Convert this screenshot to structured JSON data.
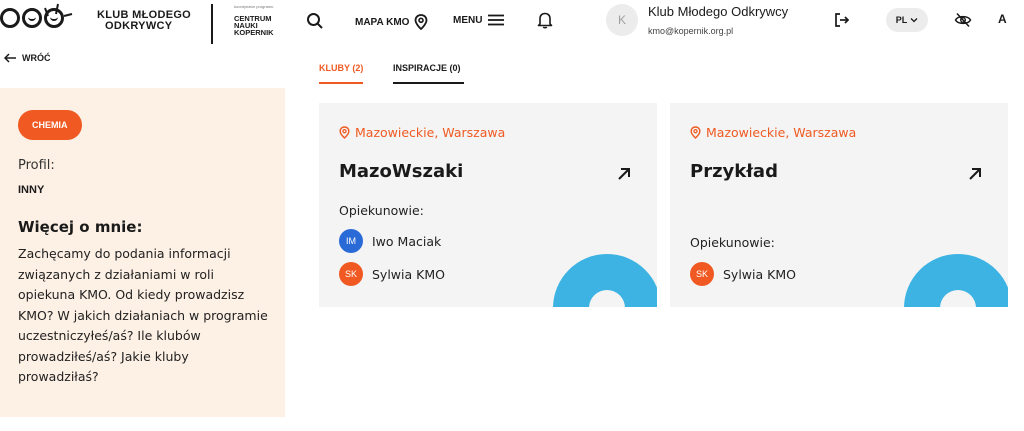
{
  "header": {
    "logo_line1": "KLUB MŁODEGO",
    "logo_line2": "ODKRYWCY",
    "partner_small": "koordynator programu",
    "partner_line1": "CENTRUM",
    "partner_line2": "NAUKI",
    "partner_line3": "KOPERNIK",
    "map_label": "MAPA KMO",
    "menu_label": "MENU",
    "user_initial": "K",
    "user_name": "Klub Młodego Odkrywcy",
    "user_email": "kmo@kopernik.org.pl",
    "lang": "PL",
    "font_size_label": "A"
  },
  "back_label": "WRÓĆ",
  "tabs": [
    {
      "label": "KLUBY (2)",
      "active": true
    },
    {
      "label": "INSPIRACJE (0)",
      "active": false
    }
  ],
  "profile": {
    "chip": "CHEMIA",
    "profile_label": "Profil:",
    "profile_value": "INNY",
    "about_heading": "Więcej o mnie:",
    "about_text": "Zachęcamy do podania informacji związanych z działaniami w roli opiekuna KMO. Od kiedy prowadzisz KMO? W jakich działaniach w programie uczestniczyłeś/aś? Ile klubów prowadziłeś/aś? Jakie kluby prowadziłaś?"
  },
  "clubs": [
    {
      "location": "Mazowieckie, Warszawa",
      "name": "MazoWszaki",
      "guardians_label": "Opiekunowie:",
      "guardians": [
        {
          "initials": "IM",
          "name": "Iwo Maciak",
          "color": "#2a6ad6"
        },
        {
          "initials": "SK",
          "name": "Sylwia KMO",
          "color": "#f05a22"
        }
      ]
    },
    {
      "location": "Mazowieckie, Warszawa",
      "name": "Przykład",
      "guardians_label": "Opiekunowie:",
      "guardians": [
        {
          "initials": "SK",
          "name": "Sylwia KMO",
          "color": "#f05a22"
        }
      ]
    }
  ],
  "colors": {
    "accent": "#f05a22",
    "panel_bg": "#fdf0e4",
    "card_bg": "#f4f4f4",
    "deco_blue": "#3db3e3",
    "badge_blue": "#2a6ad6"
  }
}
